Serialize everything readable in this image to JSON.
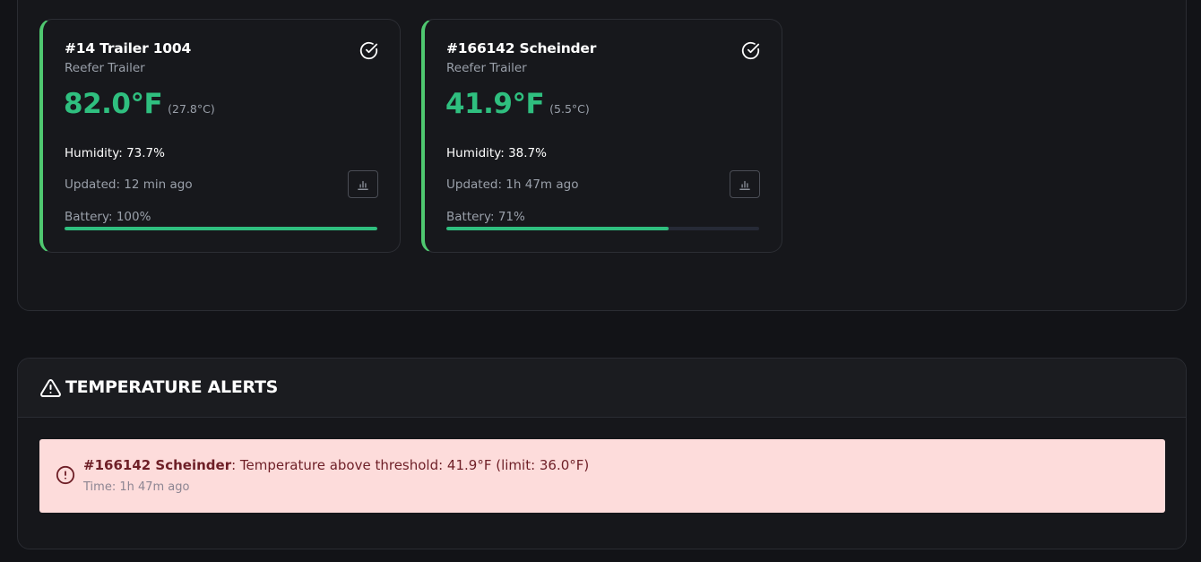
{
  "sensors": [
    {
      "title": "#14 Trailer 1004",
      "type": "Reefer Trailer",
      "temp_f": "82.0°F",
      "temp_c": "(27.8°C)",
      "humidity": "Humidity: 73.7%",
      "updated": "Updated: 12 min ago",
      "battery": "Battery: 100%",
      "battery_level": 1.0,
      "status_icon": "check-circle-icon",
      "chart_icon": "bar-chart-icon"
    },
    {
      "title": "#166142 Scheinder",
      "type": "Reefer Trailer",
      "temp_f": "41.9°F",
      "temp_c": "(5.5°C)",
      "humidity": "Humidity: 38.7%",
      "updated": "Updated: 1h 47m ago",
      "battery": "Battery: 71%",
      "battery_level": 0.71,
      "status_icon": "check-circle-icon",
      "chart_icon": "bar-chart-icon"
    }
  ],
  "alerts": {
    "title": "TEMPERATURE ALERTS",
    "title_icon": "warning-triangle-icon",
    "items": [
      {
        "sensor": "#166142 Scheinder",
        "message": ": Temperature above threshold: 41.9°F (limit: 36.0°F)",
        "time": "Time: 1h 47m ago",
        "icon": "alert-circle-icon"
      }
    ]
  },
  "colors": {
    "accent_green": "#2fbf7f",
    "card_border_green": "#4fc870",
    "alert_bg": "#fddcdb",
    "alert_text": "#6e1f27",
    "background": "#121317"
  }
}
